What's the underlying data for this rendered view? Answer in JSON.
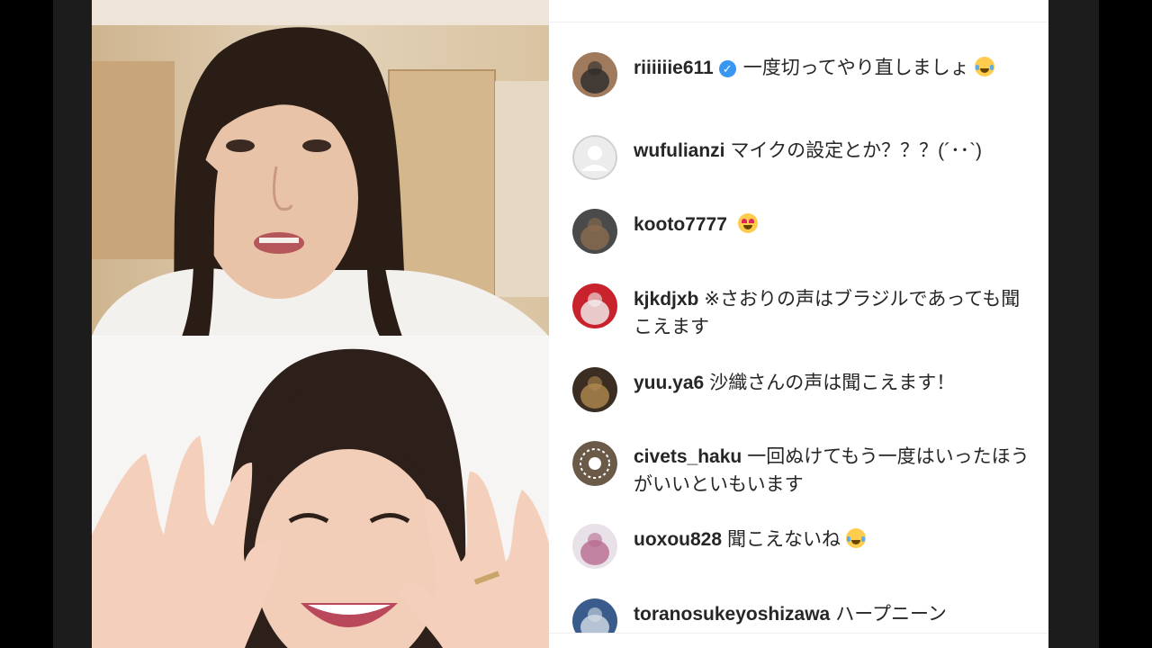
{
  "live": {
    "top_participant": "host-video",
    "bottom_participant": "guest-video"
  },
  "comments": [
    {
      "username": "riiiiiie611",
      "verified": true,
      "text": "一度切ってやり直しましょ",
      "emoji": "joy-icon"
    },
    {
      "username": "wufulianzi",
      "verified": false,
      "text": "マイクの設定とか？？？(´･･`)",
      "emoji": ""
    },
    {
      "username": "kooto7777",
      "verified": false,
      "text": "",
      "emoji": "heart-eyes-icon"
    },
    {
      "username": "kjkdjxb",
      "verified": false,
      "text": "※さおりの声はブラジルであっても聞こえます",
      "emoji": ""
    },
    {
      "username": "yuu.ya6",
      "verified": false,
      "text": "沙織さんの声は聞こえます！",
      "emoji": ""
    },
    {
      "username": "civets_haku",
      "verified": false,
      "text": "一回ぬけてもう一度はいったほうがいいといもいます",
      "emoji": ""
    },
    {
      "username": "uoxou828",
      "verified": false,
      "text": "聞こえないね",
      "emoji": "sob-icon"
    },
    {
      "username": "toranosukeyoshizawa",
      "verified": false,
      "text": "ハープニーン",
      "emoji": ""
    }
  ],
  "colors": {
    "verified": "#3897f0",
    "text": "#262626",
    "panel_bg": "#ffffff"
  }
}
